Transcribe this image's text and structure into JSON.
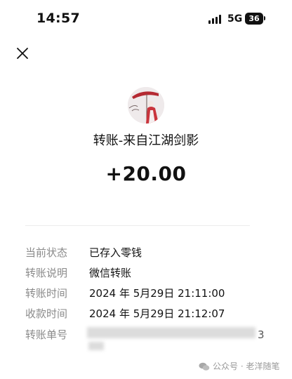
{
  "status_bar": {
    "time": "14:57",
    "network": "5G",
    "battery": "36"
  },
  "payer": {
    "title": "转账-来自江湖剑影",
    "avatar": "red-umbrella-figure-avatar"
  },
  "amount": "+20.00",
  "details": [
    {
      "label": "当前状态",
      "value": "已存入零钱"
    },
    {
      "label": "转账说明",
      "value": "微信转账"
    },
    {
      "label": "转账时间",
      "value": "2024 年 5月29日 21:11:00"
    },
    {
      "label": "收款时间",
      "value": "2024 年 5月29日 21:12:07"
    },
    {
      "label": "转账单号",
      "value": ""
    }
  ],
  "serial_tail": "3",
  "watermark": "公众号 · 老洋随笔",
  "icons": {
    "close": "close-icon",
    "signal": "signal-icon",
    "wechat": "wechat-icon"
  }
}
